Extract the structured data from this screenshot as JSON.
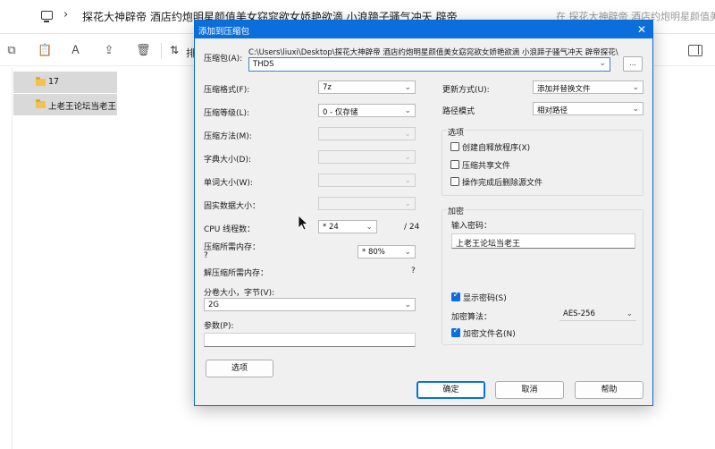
{
  "explorer": {
    "address_path": "探花大神辟帝 酒店约炮明星颜值美女窈窕欲女娇艳欲滴 小浪蹄子骚气冲天 辟帝探花",
    "search_placeholder": "在 探花大神辟帝 酒店约炮明星颜值美",
    "sort_label": "排",
    "files": [
      {
        "name": "17"
      },
      {
        "name": "上老王论坛当老王"
      }
    ]
  },
  "dialog": {
    "title": "添加到压缩包",
    "archive_label": "压缩包(A):",
    "archive_path": "C:\\Users\\liuxi\\Desktop\\探花大神辟帝 酒店约炮明星颜值美女窈窕欲女娇艳欲滴 小浪蹄子骚气冲天 辟帝探花\\",
    "archive_name": "THDS",
    "browse_label": "...",
    "left": {
      "format_label": "压缩格式(F):",
      "format_value": "7z",
      "level_label": "压缩等级(L):",
      "level_value": "0 - 仅存储",
      "method_label": "压缩方法(M):",
      "dict_label": "字典大小(D):",
      "word_label": "单词大小(W):",
      "solid_label": "固实数据大小：",
      "threads_label": "CPU 线程数：",
      "threads_value": "* 24",
      "threads_total": "/ 24",
      "mem_compress_label": "压缩所需内存：",
      "mem_compress_q": "?",
      "mem_compress_value": "* 80%",
      "mem_decompress_label": "解压缩所需内存：",
      "mem_decompress_q": "?",
      "split_label": "分卷大小，字节(V):",
      "split_value": "2G",
      "params_label": "参数(P):",
      "params_value": "",
      "options_button": "选项"
    },
    "right": {
      "update_label": "更新方式(U):",
      "update_value": "添加并替换文件",
      "path_mode_label": "路径模式",
      "path_mode_value": "相对路径",
      "options_group": "选项",
      "opt_sfx": "创建自释放程序(X)",
      "opt_shared": "压缩共享文件",
      "opt_delete": "操作完成后删除源文件",
      "encrypt_group": "加密",
      "password_label": "输入密码：",
      "password_value": "上老王论坛当老王",
      "show_password": "显示密码(S)",
      "method_label": "加密算法：",
      "method_value": "AES-256",
      "encrypt_names": "加密文件名(N)"
    },
    "buttons": {
      "ok": "确定",
      "cancel": "取消",
      "help": "帮助"
    }
  },
  "colors": {
    "accent": "#0a6fdc",
    "folder": "#f2c14e"
  }
}
